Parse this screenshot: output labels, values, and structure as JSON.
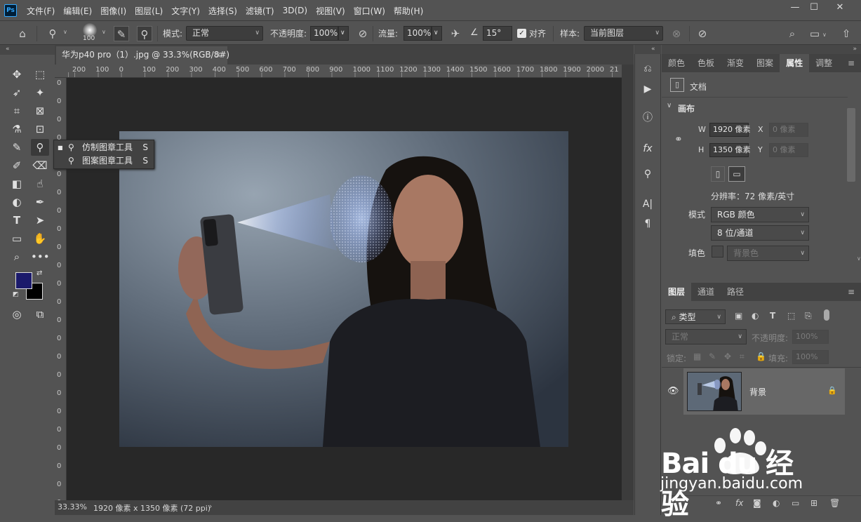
{
  "app": {
    "logo": "Ps"
  },
  "menu": [
    "文件(F)",
    "编辑(E)",
    "图像(I)",
    "图层(L)",
    "文字(Y)",
    "选择(S)",
    "滤镜(T)",
    "3D(D)",
    "视图(V)",
    "窗口(W)",
    "帮助(H)"
  ],
  "window_controls": [
    "—",
    "☐",
    "✕"
  ],
  "options": {
    "brush_size": "100",
    "mode_label": "模式:",
    "mode_value": "正常",
    "opacity_label": "不透明度:",
    "opacity_value": "100%",
    "flow_label": "流量:",
    "flow_value": "100%",
    "angle_value": "15°",
    "align_label": "对齐",
    "sample_label": "样本:",
    "sample_value": "当前图层"
  },
  "flyout": {
    "items": [
      {
        "label": "仿制图章工具",
        "shortcut": "S",
        "selected": true
      },
      {
        "label": "图案图章工具",
        "shortcut": "S",
        "selected": false
      }
    ]
  },
  "document": {
    "tab_title": "华为p40 pro（1）.jpg @ 33.3%(RGB/8#)",
    "zoom": "33.33%",
    "status": "1920 像素 x 1350 像素 (72 ppi)"
  },
  "ruler": {
    "h_ticks": [
      "200",
      "100",
      "0",
      "100",
      "200",
      "300",
      "400",
      "500",
      "600",
      "700",
      "800",
      "900",
      "1000",
      "1100",
      "1200",
      "1300",
      "1400",
      "1500",
      "1600",
      "1700",
      "1800",
      "1900",
      "2000",
      "21"
    ],
    "v_ticks": [
      "0",
      "0",
      "0",
      "0",
      "0",
      "0",
      "0",
      "0",
      "0",
      "0",
      "0",
      "0",
      "0",
      "0",
      "0",
      "0",
      "0",
      "0",
      "0",
      "0",
      "0",
      "0",
      "0",
      "0"
    ]
  },
  "properties_panel": {
    "tabs": [
      "颜色",
      "色板",
      "渐变",
      "图案",
      "属性",
      "调整"
    ],
    "active_tab": "属性",
    "doc_label": "文档",
    "section": "画布",
    "w_label": "W",
    "w_value": "1920 像素",
    "h_label": "H",
    "h_value": "1350 像素",
    "x_label": "X",
    "x_value": "0 像素",
    "y_label": "Y",
    "y_value": "0 像素",
    "resolution": "分辨率：72 像素/英寸",
    "mode_label": "模式",
    "mode_value": "RGB 颜色",
    "depth_value": "8 位/通道",
    "fill_label": "填色",
    "fill_value": "背景色"
  },
  "layers_panel": {
    "tabs": [
      "图层",
      "通道",
      "路径"
    ],
    "active_tab": "图层",
    "filter_label": "类型",
    "blend_value": "正常",
    "opacity_label": "不透明度:",
    "opacity_value": "100%",
    "lock_label": "锁定:",
    "fill_label": "填充:",
    "fill_value": "100%",
    "layers": [
      {
        "name": "背景",
        "visible": true,
        "locked": true
      }
    ]
  },
  "watermark": {
    "brand": "Bai du 经验",
    "url": "jingyan.baidu.com"
  },
  "colors": {
    "foreground": "#1b1a6b",
    "background": "#000000",
    "accent": "#31a8ff"
  }
}
